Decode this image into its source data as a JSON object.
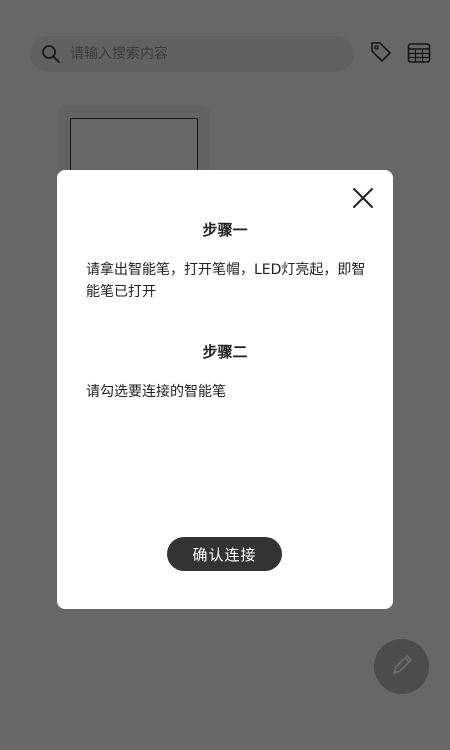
{
  "search": {
    "placeholder": "请输入搜索内容"
  },
  "header": {
    "tag_icon": "tag-icon",
    "grid_icon": "grid-table-icon",
    "search_icon": "search-icon"
  },
  "fab": {
    "icon": "pen-icon"
  },
  "dialog": {
    "close_icon": "close-icon",
    "step1_title": "步骤一",
    "step1_text": "请拿出智能笔，打开笔帽，LED灯亮起，即智能笔已打开",
    "step2_title": "步骤二",
    "step2_text": "请勾选要连接的智能笔",
    "confirm_label": "确认连接"
  },
  "colors": {
    "overlay": "#000000",
    "dialog_bg": "#ffffff",
    "button_bg": "#333333",
    "button_text": "#ffffff"
  }
}
